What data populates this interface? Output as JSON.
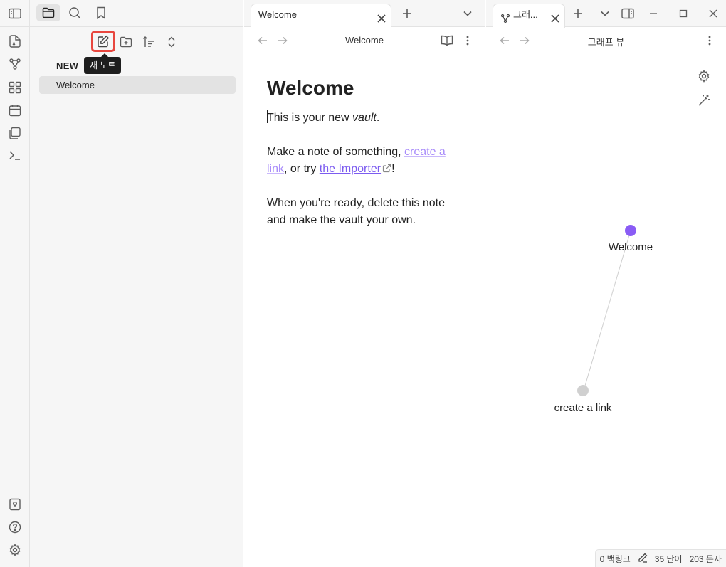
{
  "ribbon": {
    "icons": [
      "sidebar-toggle-icon",
      "open-quick-switcher-icon",
      "graph-view-icon",
      "canvas-icon",
      "daily-note-icon",
      "templates-icon",
      "command-palette-icon",
      "vault-switch-icon",
      "help-icon",
      "settings-icon"
    ]
  },
  "sidebar": {
    "tabs": [
      "files-icon",
      "search-icon",
      "bookmark-icon"
    ],
    "tooltip": "새 노트",
    "vault_name": "NEW",
    "files": [
      {
        "label": "Welcome"
      }
    ]
  },
  "editor": {
    "tab_title": "Welcome",
    "view_title": "Welcome",
    "heading": "Welcome",
    "p1_before": "This is your new ",
    "p1_em": "vault",
    "p1_after": ".",
    "p2_before": "Make a note of something, ",
    "p2_link": "create a link",
    "p2_mid": ", or try ",
    "p2_ext": "the Importer",
    "p2_after": "!",
    "p3": "When you're ready, delete this note and make the vault your own."
  },
  "graph": {
    "tab_title": "그래...",
    "view_title": "그래프 뷰",
    "accent": "#7c5cf0",
    "nodes": [
      {
        "label": "Welcome",
        "color": "#8a5cf5"
      },
      {
        "label": "create a link",
        "color": "#d0d0d0"
      }
    ]
  },
  "status": {
    "backlinks": "0 백링크",
    "words": "35 단어",
    "chars": "203 문자"
  }
}
